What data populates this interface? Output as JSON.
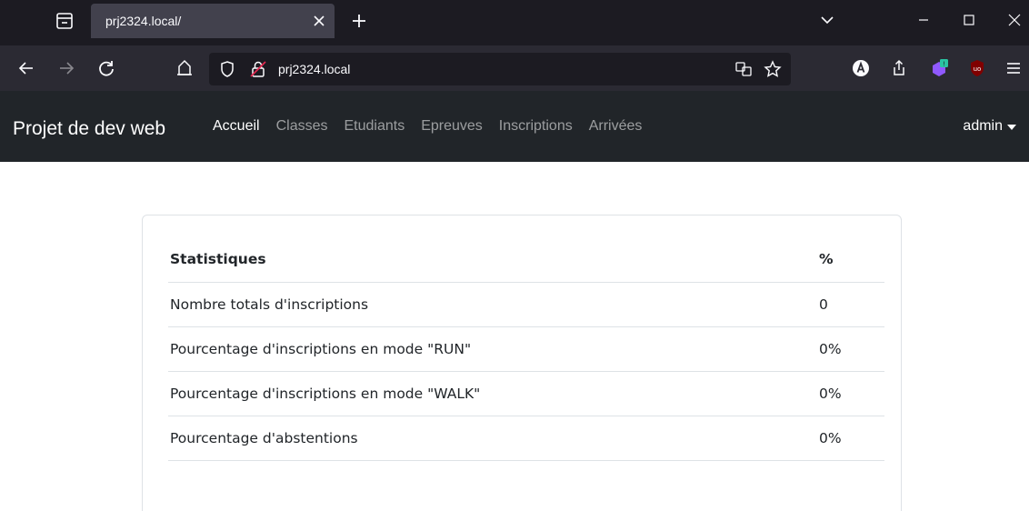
{
  "browser": {
    "tab": {
      "title": "prj2324.local/"
    },
    "url": "prj2324.local"
  },
  "app": {
    "brand": "Projet de dev web",
    "nav": [
      {
        "label": "Accueil",
        "active": true
      },
      {
        "label": "Classes",
        "active": false
      },
      {
        "label": "Etudiants",
        "active": false
      },
      {
        "label": "Epreuves",
        "active": false
      },
      {
        "label": "Inscriptions",
        "active": false
      },
      {
        "label": "Arrivées",
        "active": false
      }
    ],
    "user": "admin"
  },
  "stats": {
    "headers": {
      "label": "Statistiques",
      "value": "%"
    },
    "rows": [
      {
        "label": "Nombre totals d'inscriptions",
        "value": "0"
      },
      {
        "label": "Pourcentage d'inscriptions en mode \"RUN\"",
        "value": "0%"
      },
      {
        "label": "Pourcentage d'inscriptions en mode \"WALK\"",
        "value": "0%"
      },
      {
        "label": "Pourcentage d'abstentions",
        "value": "0%"
      }
    ]
  }
}
